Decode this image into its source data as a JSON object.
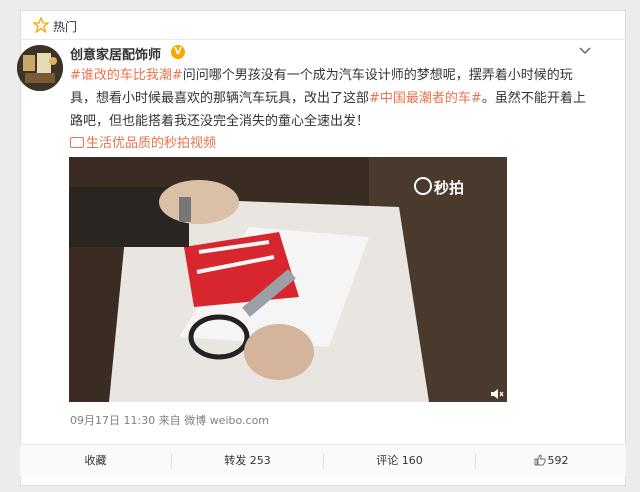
{
  "hot": {
    "label": "热门"
  },
  "post": {
    "username": "创意家居配饰师",
    "verified_badge": "V",
    "text": {
      "tag1": "#谁改的车比我潮#",
      "body1": "问问哪个男孩没有一个成为汽车设计师的梦想呢，摆弄着小时候的玩具，想看小时候最喜欢的那辆汽车玩具，改出了这部",
      "tag2": "#中国最潮者的车#",
      "body2": "。虽然不能开着上路吧，但也能搭着我还没完全消失的童心全速出发！"
    },
    "source": "生活优品质的秒拍视频",
    "video": {
      "watermark": "秒拍"
    },
    "meta": "09月17日 11:30 来自 微博 weibo.com"
  },
  "actions": {
    "favorite": "收藏",
    "repost": "转发 253",
    "comment": "评论 160",
    "like": "592"
  },
  "colors": {
    "accent": "#eb7350",
    "text": "#333333",
    "meta": "#808080"
  }
}
